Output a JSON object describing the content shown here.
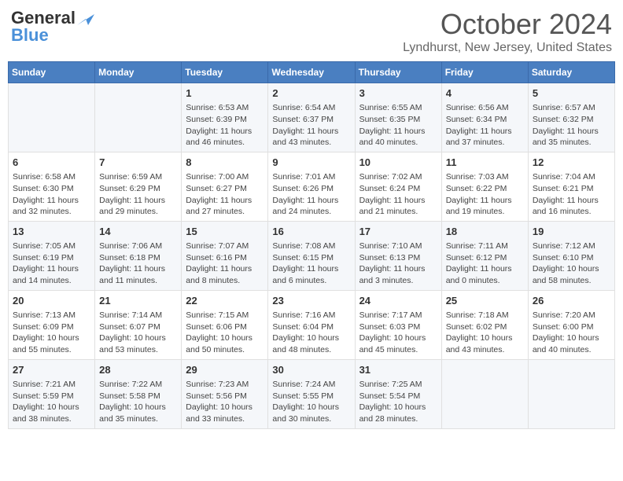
{
  "header": {
    "logo_general": "General",
    "logo_blue": "Blue",
    "title": "October 2024",
    "location": "Lyndhurst, New Jersey, United States"
  },
  "days_of_week": [
    "Sunday",
    "Monday",
    "Tuesday",
    "Wednesday",
    "Thursday",
    "Friday",
    "Saturday"
  ],
  "weeks": [
    [
      {
        "day": "",
        "content": ""
      },
      {
        "day": "",
        "content": ""
      },
      {
        "day": "1",
        "content": "Sunrise: 6:53 AM\nSunset: 6:39 PM\nDaylight: 11 hours and 46 minutes."
      },
      {
        "day": "2",
        "content": "Sunrise: 6:54 AM\nSunset: 6:37 PM\nDaylight: 11 hours and 43 minutes."
      },
      {
        "day": "3",
        "content": "Sunrise: 6:55 AM\nSunset: 6:35 PM\nDaylight: 11 hours and 40 minutes."
      },
      {
        "day": "4",
        "content": "Sunrise: 6:56 AM\nSunset: 6:34 PM\nDaylight: 11 hours and 37 minutes."
      },
      {
        "day": "5",
        "content": "Sunrise: 6:57 AM\nSunset: 6:32 PM\nDaylight: 11 hours and 35 minutes."
      }
    ],
    [
      {
        "day": "6",
        "content": "Sunrise: 6:58 AM\nSunset: 6:30 PM\nDaylight: 11 hours and 32 minutes."
      },
      {
        "day": "7",
        "content": "Sunrise: 6:59 AM\nSunset: 6:29 PM\nDaylight: 11 hours and 29 minutes."
      },
      {
        "day": "8",
        "content": "Sunrise: 7:00 AM\nSunset: 6:27 PM\nDaylight: 11 hours and 27 minutes."
      },
      {
        "day": "9",
        "content": "Sunrise: 7:01 AM\nSunset: 6:26 PM\nDaylight: 11 hours and 24 minutes."
      },
      {
        "day": "10",
        "content": "Sunrise: 7:02 AM\nSunset: 6:24 PM\nDaylight: 11 hours and 21 minutes."
      },
      {
        "day": "11",
        "content": "Sunrise: 7:03 AM\nSunset: 6:22 PM\nDaylight: 11 hours and 19 minutes."
      },
      {
        "day": "12",
        "content": "Sunrise: 7:04 AM\nSunset: 6:21 PM\nDaylight: 11 hours and 16 minutes."
      }
    ],
    [
      {
        "day": "13",
        "content": "Sunrise: 7:05 AM\nSunset: 6:19 PM\nDaylight: 11 hours and 14 minutes."
      },
      {
        "day": "14",
        "content": "Sunrise: 7:06 AM\nSunset: 6:18 PM\nDaylight: 11 hours and 11 minutes."
      },
      {
        "day": "15",
        "content": "Sunrise: 7:07 AM\nSunset: 6:16 PM\nDaylight: 11 hours and 8 minutes."
      },
      {
        "day": "16",
        "content": "Sunrise: 7:08 AM\nSunset: 6:15 PM\nDaylight: 11 hours and 6 minutes."
      },
      {
        "day": "17",
        "content": "Sunrise: 7:10 AM\nSunset: 6:13 PM\nDaylight: 11 hours and 3 minutes."
      },
      {
        "day": "18",
        "content": "Sunrise: 7:11 AM\nSunset: 6:12 PM\nDaylight: 11 hours and 0 minutes."
      },
      {
        "day": "19",
        "content": "Sunrise: 7:12 AM\nSunset: 6:10 PM\nDaylight: 10 hours and 58 minutes."
      }
    ],
    [
      {
        "day": "20",
        "content": "Sunrise: 7:13 AM\nSunset: 6:09 PM\nDaylight: 10 hours and 55 minutes."
      },
      {
        "day": "21",
        "content": "Sunrise: 7:14 AM\nSunset: 6:07 PM\nDaylight: 10 hours and 53 minutes."
      },
      {
        "day": "22",
        "content": "Sunrise: 7:15 AM\nSunset: 6:06 PM\nDaylight: 10 hours and 50 minutes."
      },
      {
        "day": "23",
        "content": "Sunrise: 7:16 AM\nSunset: 6:04 PM\nDaylight: 10 hours and 48 minutes."
      },
      {
        "day": "24",
        "content": "Sunrise: 7:17 AM\nSunset: 6:03 PM\nDaylight: 10 hours and 45 minutes."
      },
      {
        "day": "25",
        "content": "Sunrise: 7:18 AM\nSunset: 6:02 PM\nDaylight: 10 hours and 43 minutes."
      },
      {
        "day": "26",
        "content": "Sunrise: 7:20 AM\nSunset: 6:00 PM\nDaylight: 10 hours and 40 minutes."
      }
    ],
    [
      {
        "day": "27",
        "content": "Sunrise: 7:21 AM\nSunset: 5:59 PM\nDaylight: 10 hours and 38 minutes."
      },
      {
        "day": "28",
        "content": "Sunrise: 7:22 AM\nSunset: 5:58 PM\nDaylight: 10 hours and 35 minutes."
      },
      {
        "day": "29",
        "content": "Sunrise: 7:23 AM\nSunset: 5:56 PM\nDaylight: 10 hours and 33 minutes."
      },
      {
        "day": "30",
        "content": "Sunrise: 7:24 AM\nSunset: 5:55 PM\nDaylight: 10 hours and 30 minutes."
      },
      {
        "day": "31",
        "content": "Sunrise: 7:25 AM\nSunset: 5:54 PM\nDaylight: 10 hours and 28 minutes."
      },
      {
        "day": "",
        "content": ""
      },
      {
        "day": "",
        "content": ""
      }
    ]
  ]
}
